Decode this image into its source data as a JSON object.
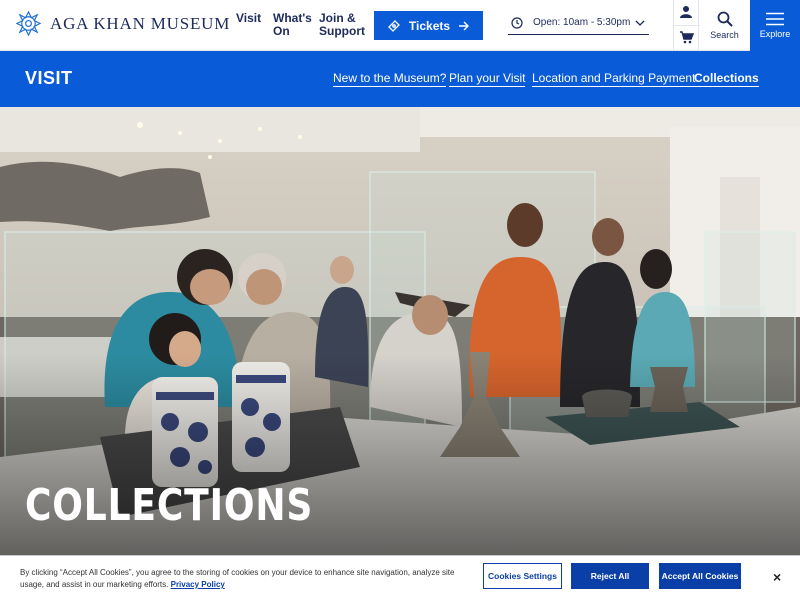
{
  "header": {
    "logo_text": "AGA KHAN MUSEUM",
    "nav": [
      {
        "line1": "Visit",
        "line2": ""
      },
      {
        "line1": "What's",
        "line2": "On"
      },
      {
        "line1": "Join &",
        "line2": "Support"
      }
    ],
    "tickets_label": "Tickets",
    "hours_label": "Open: 10am - 5:30pm",
    "search_label": "Search",
    "explore_label": "Explore"
  },
  "visit_bar": {
    "title": "VISIT",
    "links": [
      "New to the Museum?",
      "Plan your Visit",
      "Location and Parking Payment",
      "Collections"
    ],
    "active_link": "Collections"
  },
  "hero": {
    "title": "COLLECTIONS"
  },
  "cookie": {
    "text": "By clicking “Accept All Cookies”, you agree to the storing of cookies on your device to enhance site navigation, analyze site usage, and assist in our marketing efforts.",
    "policy_link": "Privacy Policy",
    "settings_label": "Cookies Settings",
    "reject_label": "Reject All",
    "accept_label": "Accept All Cookies",
    "close_symbol": "×"
  },
  "colors": {
    "brand_blue": "#0a5bd8",
    "navy": "#1d2a5b",
    "cookie_blue": "#0a3fa8"
  },
  "icons": [
    "logo-rosette-icon",
    "ticket-icon",
    "arrow-right-icon",
    "clock-icon",
    "chevron-down-icon",
    "user-icon",
    "cart-icon",
    "search-icon",
    "menu-icon",
    "close-icon"
  ]
}
